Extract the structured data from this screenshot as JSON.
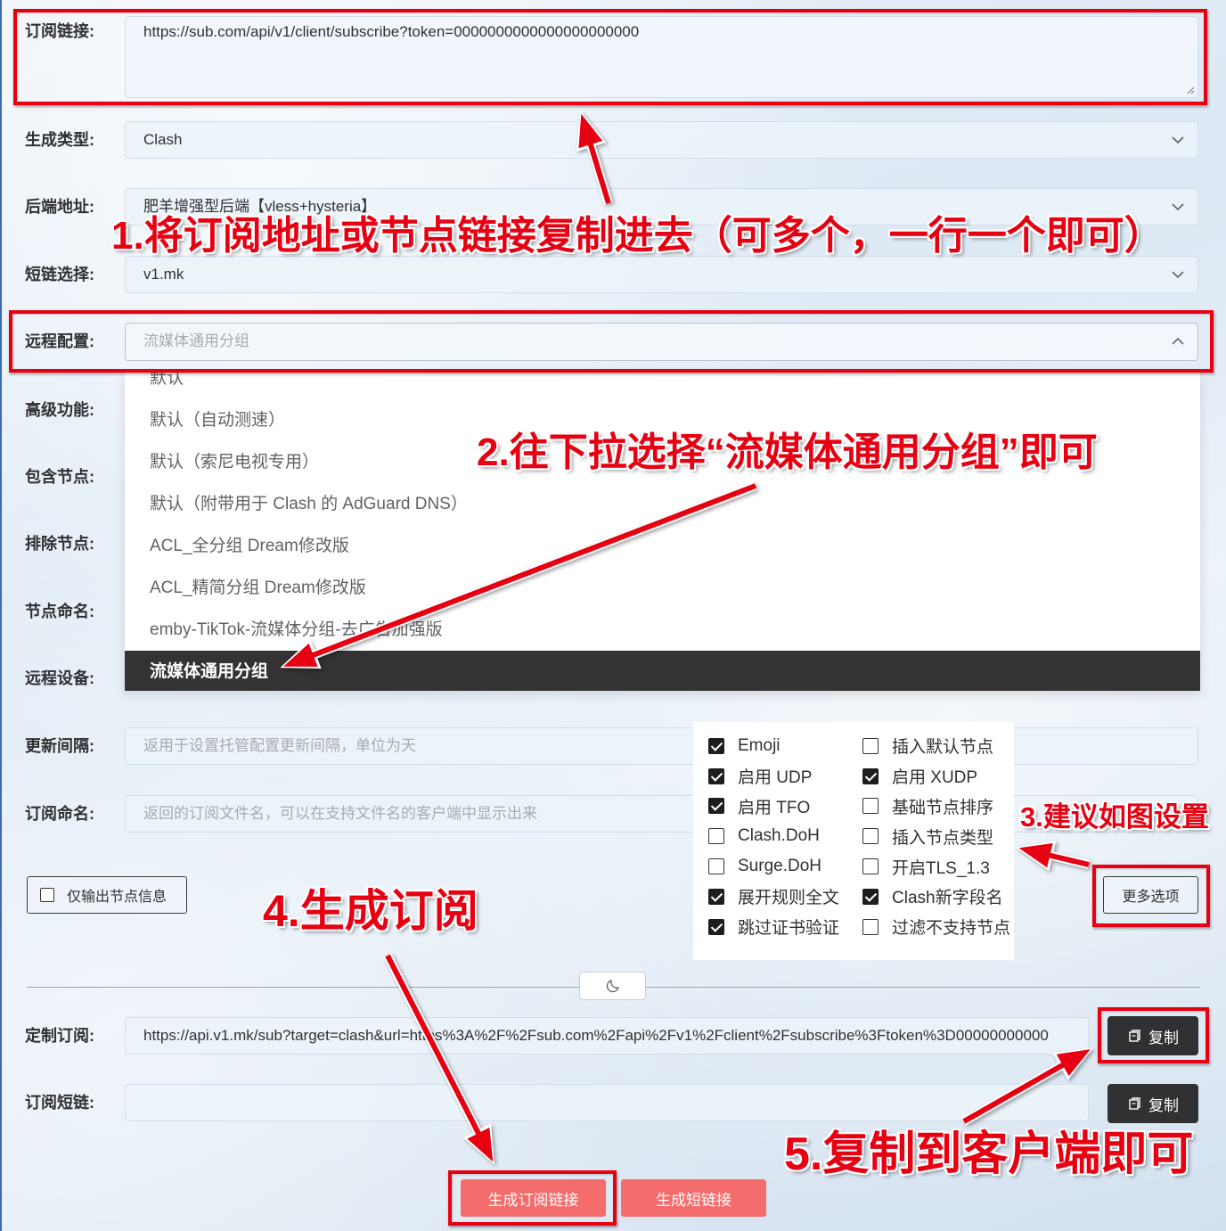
{
  "form": {
    "subscription_link": {
      "label": "订阅链接:",
      "value": "https://sub.com/api/v1/client/subscribe?token=0000000000000000000000"
    },
    "generate_type": {
      "label": "生成类型:",
      "value": "Clash"
    },
    "backend": {
      "label": "后端地址:",
      "value": "肥羊增强型后端【vless+hysteria】"
    },
    "short_link_select": {
      "label": "短链选择:",
      "value": "v1.mk"
    },
    "remote_config": {
      "label": "远程配置:",
      "placeholder": "流媒体通用分组",
      "selected_index": 7,
      "options": [
        "默认",
        "默认（自动测速）",
        "默认（索尼电视专用）",
        "默认（附带用于 Clash 的 AdGuard DNS）",
        "ACL_全分组 Dream修改版",
        "ACL_精简分组 Dream修改版",
        "emby-TikTok-流媒体分组-去广告加强版",
        "流媒体通用分组"
      ]
    },
    "advanced": {
      "label": "高级功能:"
    },
    "include_nodes": {
      "label": "包含节点:"
    },
    "exclude_nodes": {
      "label": "排除节点:"
    },
    "node_naming": {
      "label": "节点命名:"
    },
    "remote_device": {
      "label": "远程设备:"
    },
    "update_interval": {
      "label": "更新间隔:",
      "placeholder": "返用于设置托管配置更新间隔，单位为天"
    },
    "subscription_name": {
      "label": "订阅命名:",
      "placeholder": "返回的订阅文件名，可以在支持文件名的客户端中显示出来"
    },
    "node_info_only": {
      "label": "仅输出节点信息",
      "checked": false
    },
    "more_options_button": "更多选项"
  },
  "options_popup": {
    "left_column": [
      {
        "label": "Emoji",
        "checked": true
      },
      {
        "label": "启用 UDP",
        "checked": true
      },
      {
        "label": "启用 TFO",
        "checked": true
      },
      {
        "label": "Clash.DoH",
        "checked": false
      },
      {
        "label": "Surge.DoH",
        "checked": false
      },
      {
        "label": "展开规则全文",
        "checked": true
      },
      {
        "label": "跳过证书验证",
        "checked": true
      }
    ],
    "right_column": [
      {
        "label": "插入默认节点",
        "checked": false
      },
      {
        "label": "启用 XUDP",
        "checked": true
      },
      {
        "label": "基础节点排序",
        "checked": false
      },
      {
        "label": "插入节点类型",
        "checked": false
      },
      {
        "label": "开启TLS_1.3",
        "checked": false
      },
      {
        "label": "Clash新字段名",
        "checked": true
      },
      {
        "label": "过滤不支持节点",
        "checked": false
      }
    ]
  },
  "result": {
    "custom_subscription": {
      "label": "定制订阅:",
      "value": "https://api.v1.mk/sub?target=clash&url=https%3A%2F%2Fsub.com%2Fapi%2Fv1%2Fclient%2Fsubscribe%3Ftoken%3D00000000000",
      "copy_button": "复制"
    },
    "short_link": {
      "label": "订阅短链:",
      "value": "",
      "copy_button": "复制"
    }
  },
  "actions": {
    "generate_subscription": "生成订阅链接",
    "generate_short_link": "生成短链接"
  },
  "annotations": {
    "step1": "1.将订阅地址或节点链接复制进去（可多个，一行一个即可）",
    "step2": "2.往下拉选择“流媒体通用分组”即可",
    "step3": "3.建议如图设置",
    "step4": "4.生成订阅",
    "step5": "5.复制到客户端即可"
  },
  "icons": {
    "select_arrow": "chevron-down-icon",
    "open_select_arrow": "chevron-up-icon",
    "theme_toggle": "moon-icon",
    "copy": "copy-icon",
    "checkbox_checked": "check-icon"
  },
  "colors": {
    "annotation_red": "#e60012",
    "primary_button": "#f56c6c",
    "copy_button": "#303133",
    "selected_option_bg": "#333333"
  }
}
